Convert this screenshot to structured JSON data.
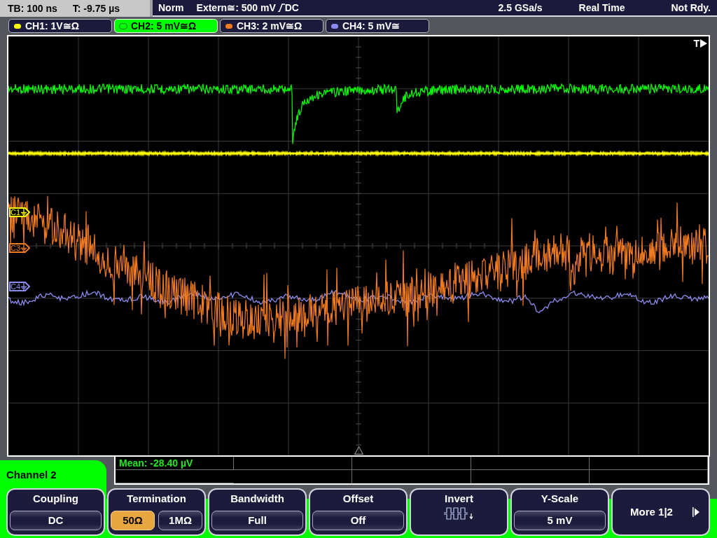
{
  "status_bar": {
    "timebase": "TB: 100 ns",
    "trigger_time": "T: -9.75 µs",
    "trigger_mode": "Norm",
    "trigger_source": "Extern≅: 500 mV",
    "trigger_coupling": "DC",
    "sample_rate": "2.5 GSa/s",
    "acquisition_mode": "Real Time",
    "acquisition_state": "Not Rdy."
  },
  "channel_tabs": [
    {
      "label": "CH1: 1V≅Ω",
      "color": "#ffff00",
      "selected": false
    },
    {
      "label": "CH2: 5 mV≅Ω",
      "color": "#00ff00",
      "selected": true
    },
    {
      "label": "CH3: 2 mV≅Ω",
      "color": "#f07a20",
      "selected": false
    },
    {
      "label": "CH4: 5 mV≅",
      "color": "#8c8cf0",
      "selected": false
    }
  ],
  "display": {
    "trigger_label": "T",
    "markers": [
      {
        "label": "C1",
        "color": "#ffff00"
      },
      {
        "label": "C3",
        "color": "#f07a20"
      },
      {
        "label": "C4",
        "color": "#8c8cf0"
      }
    ]
  },
  "measurement": {
    "reading": "Mean: -28.40 µV"
  },
  "menu": {
    "title": "Channel 2",
    "softkeys": [
      {
        "kind": "value",
        "label": "Coupling",
        "value": "DC"
      },
      {
        "kind": "toggle",
        "label": "Termination",
        "options": [
          {
            "label": "50Ω",
            "selected": true
          },
          {
            "label": "1MΩ",
            "selected": false
          }
        ]
      },
      {
        "kind": "value",
        "label": "Bandwidth",
        "value": "Full"
      },
      {
        "kind": "value",
        "label": "Offset",
        "value": "Off"
      },
      {
        "kind": "icon",
        "label": "Invert"
      },
      {
        "kind": "value",
        "label": "Y-Scale",
        "value": "5 mV"
      },
      {
        "kind": "more",
        "label": "More 1|2"
      }
    ]
  }
}
